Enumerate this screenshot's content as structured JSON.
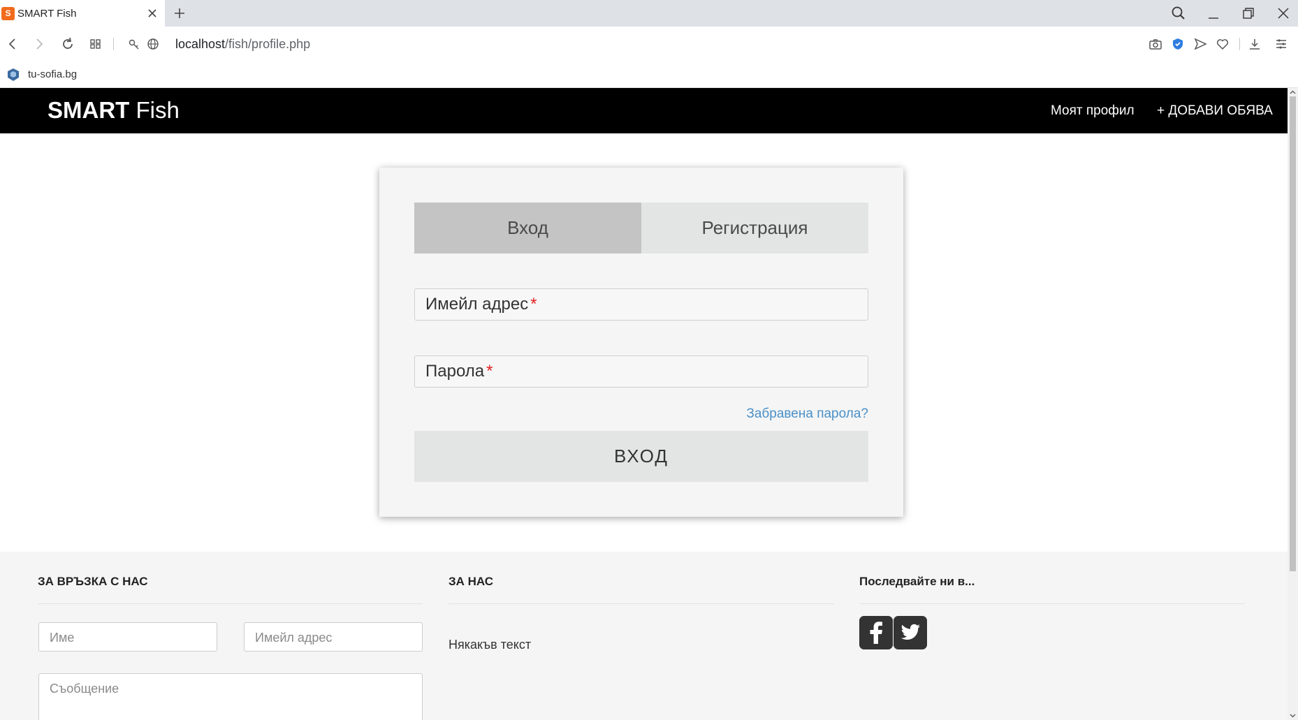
{
  "browser": {
    "tab_title": "SMART Fish",
    "favicon_text": "S",
    "url_host": "localhost",
    "url_path": "/fish/profile.php",
    "bookmark_label": "tu-sofia.bg"
  },
  "site": {
    "brand_bold": "SMART",
    "brand_light": "Fish",
    "nav_profile": "Моят профил",
    "nav_add": "+ ДОБАВИ ОБЯВА"
  },
  "login": {
    "tab_login": "Вход",
    "tab_register": "Регистрация",
    "email_label": "Имейл адрес",
    "password_label": "Парола",
    "required_mark": "*",
    "forgot_link": "Забравена парола?",
    "submit_label": "ВХОД"
  },
  "footer": {
    "contact_heading": "ЗА ВРЪЗКА С НАС",
    "about_heading": "ЗА НАС",
    "follow_heading": "Последвайте ни в...",
    "name_placeholder": "Име",
    "email_placeholder": "Имейл адрес",
    "message_placeholder": "Съобщение",
    "about_text": "Някакъв текст"
  },
  "colors": {
    "navbar": "#000000",
    "active_tab": "#c4c4c4",
    "inactive_tab": "#e3e5e4",
    "link": "#4a90c8",
    "required": "#e02020",
    "footer_bg": "#f5f5f5",
    "social_icon": "#333333"
  }
}
